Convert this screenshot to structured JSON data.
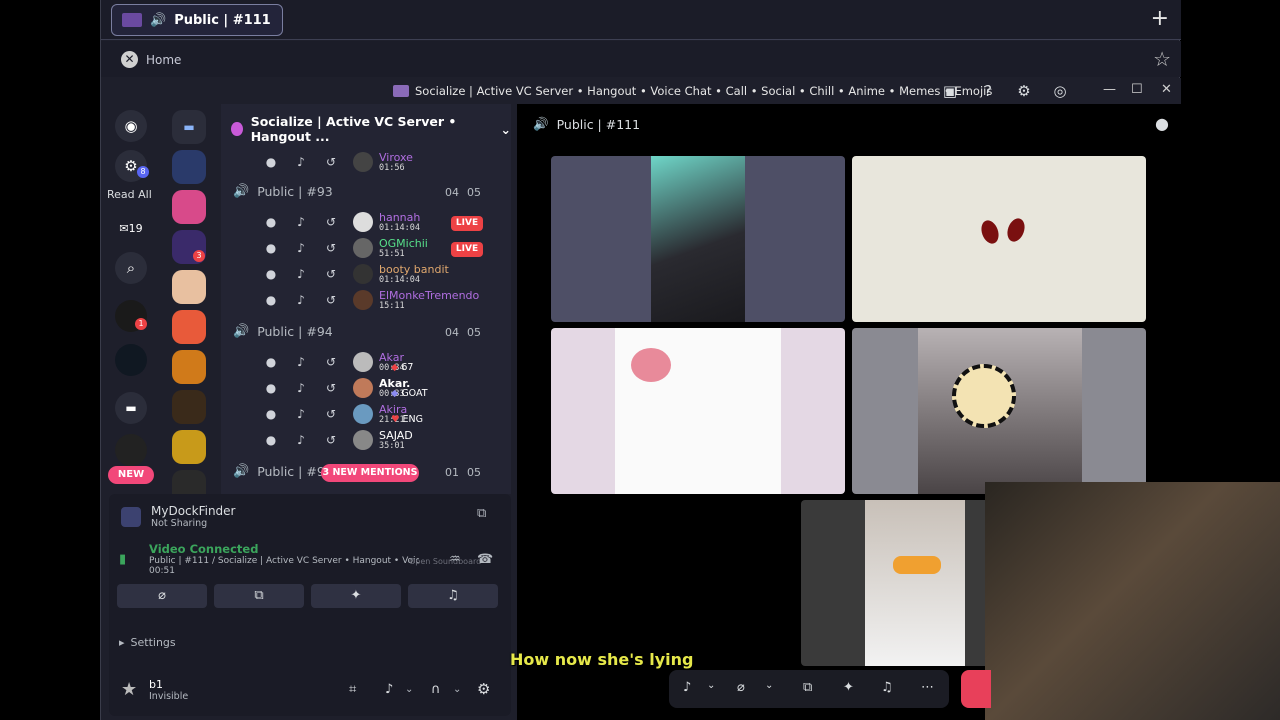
{
  "tab": {
    "title": "Public | #111"
  },
  "nav": {
    "home": "Home"
  },
  "window": {
    "title": "Socialize | Active VC Server • Hangout • Voice Chat • Call • Social • Chill • Anime • Memes • Emojis"
  },
  "rail": {
    "read_all": "Read All",
    "dm_count": "19",
    "ping1": "8",
    "ping2": "1",
    "new_badge": "NEW",
    "srv_badge": "3"
  },
  "server": {
    "name": "Socialize | Active VC Server • Hangout ..."
  },
  "channels": [
    {
      "name": "Public | #93",
      "a": "04",
      "b": "05"
    },
    {
      "name": "Public | #94",
      "a": "04",
      "b": "05"
    },
    {
      "name": "Public | #95",
      "a": "01",
      "b": "05"
    }
  ],
  "users": [
    {
      "name": "Viroxe",
      "time": "01:56",
      "color": "#b06ee0"
    },
    {
      "name": "hannah",
      "time": "01:14:04",
      "color": "#b06ee0"
    },
    {
      "name": "OGMichii",
      "time": "51:51",
      "color": "#57e08a"
    },
    {
      "name": "booty bandit",
      "time": "01:14:04",
      "color": "#e0a86e"
    },
    {
      "name": "ElMonkeTremendo",
      "time": "15:11",
      "color": "#b06ee0"
    },
    {
      "name": "Akar",
      "time": "00:34",
      "color": "#b06ee0"
    },
    {
      "name": "Akar.",
      "time": "00:33",
      "color": "#ffffff"
    },
    {
      "name": "Akira",
      "time": "21:21",
      "color": "#b06ee0"
    },
    {
      "name": "SAJAD",
      "time": "35:01",
      "color": "#ffffff"
    }
  ],
  "tags": {
    "live": "LIVE",
    "akar": "67",
    "akar2": "GOAT",
    "akira": "ENG"
  },
  "mentions": "3 NEW MENTIONS",
  "dock": {
    "name": "MyDockFinder",
    "status": "Not Sharing"
  },
  "voice": {
    "status": "Video Connected",
    "channel": "Public | #111 / Socialize | Active VC Server • Hangout • Voice Ch...",
    "time": "00:51",
    "overlay": "Open Soundboard"
  },
  "settings": {
    "label": "Settings"
  },
  "me": {
    "name": "b1",
    "status": "Invisible"
  },
  "stage": {
    "title": "Public | #111"
  },
  "caption": "How now she's lying"
}
